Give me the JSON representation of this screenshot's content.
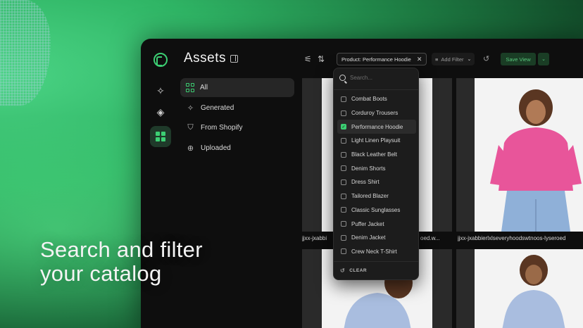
{
  "app": {
    "title": "Assets"
  },
  "nav": {
    "items": [
      {
        "label": "All",
        "icon": "grid-icon",
        "active": true
      },
      {
        "label": "Generated",
        "icon": "sparkle-icon"
      },
      {
        "label": "From Shopify",
        "icon": "shopping-bag-icon"
      },
      {
        "label": "Uploaded",
        "icon": "upload-icon"
      }
    ]
  },
  "rail": {
    "icons": [
      "logo-icon",
      "sparkle-icon",
      "tag-icon",
      "grid-icon"
    ]
  },
  "toolbar": {
    "filter_chip_label": "Product:",
    "filter_chip_value": "Performance Hoodie",
    "add_filter_label": "Add Filter",
    "save_view_label": "Save View"
  },
  "dropdown": {
    "search_placeholder": "Search...",
    "options": [
      {
        "label": "Combat Boots",
        "checked": false
      },
      {
        "label": "Corduroy Trousers",
        "checked": false
      },
      {
        "label": "Performance Hoodie",
        "checked": true
      },
      {
        "label": "Light Linen Playsuit",
        "checked": false
      },
      {
        "label": "Black Leather Belt",
        "checked": false
      },
      {
        "label": "Denim Shorts",
        "checked": false
      },
      {
        "label": "Dress Shirt",
        "checked": false
      },
      {
        "label": "Tailored Blazer",
        "checked": false
      },
      {
        "label": "Classic Sunglasses",
        "checked": false
      },
      {
        "label": "Puffer Jacket",
        "checked": false
      },
      {
        "label": "Denim Jacket",
        "checked": false
      },
      {
        "label": "Crew Neck T-Shirt",
        "checked": false
      }
    ],
    "clear_label": "CLEAR"
  },
  "grid": {
    "captions": [
      "jjxx-jxabbi",
      "oed.w...",
      "jjxx-jxabbierlxlseveryhoodswtnoos-lyseroed"
    ]
  },
  "marketing": {
    "line1": "Search and filter",
    "line2": "your catalog"
  },
  "colors": {
    "accent": "#3ccf73",
    "hoodie_pink": "#e8559a",
    "hoodie_blue": "#a9bddf"
  }
}
